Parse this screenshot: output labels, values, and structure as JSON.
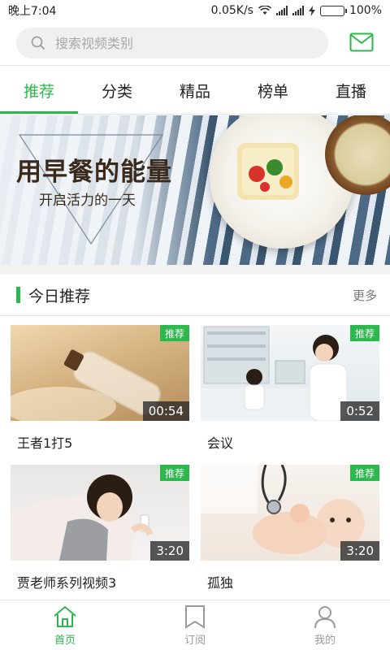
{
  "status_bar": {
    "time": "晚上7:04",
    "speed": "0.05K/s",
    "battery": "100%",
    "battery_level": 1.0
  },
  "search": {
    "placeholder": "搜索视频类别",
    "icon": "search-icon"
  },
  "header": {
    "message_icon": "mail-icon"
  },
  "tabs": [
    {
      "label": "推荐",
      "active": true
    },
    {
      "label": "分类",
      "active": false
    },
    {
      "label": "精品",
      "active": false
    },
    {
      "label": "榜单",
      "active": false
    },
    {
      "label": "直播",
      "active": false
    }
  ],
  "banner": {
    "title": "用早餐的能量",
    "subtitle": "开启活力的一天"
  },
  "section": {
    "title": "今日推荐",
    "more": "更多"
  },
  "videos": [
    {
      "title": "王者1打5",
      "duration": "00:54",
      "badge": "推荐"
    },
    {
      "title": "会议",
      "duration": "0:52",
      "badge": "推荐"
    },
    {
      "title": "贾老师系列视频3",
      "duration": "3:20",
      "badge": "推荐"
    },
    {
      "title": "孤独",
      "duration": "3:20",
      "badge": "推荐"
    }
  ],
  "bottom_nav": [
    {
      "label": "首页",
      "icon": "home-icon",
      "active": true
    },
    {
      "label": "订阅",
      "icon": "bookmark-icon",
      "active": false
    },
    {
      "label": "我的",
      "icon": "user-icon",
      "active": false
    }
  ],
  "colors": {
    "accent": "#2db84d",
    "text": "#222222",
    "muted": "#999999"
  }
}
